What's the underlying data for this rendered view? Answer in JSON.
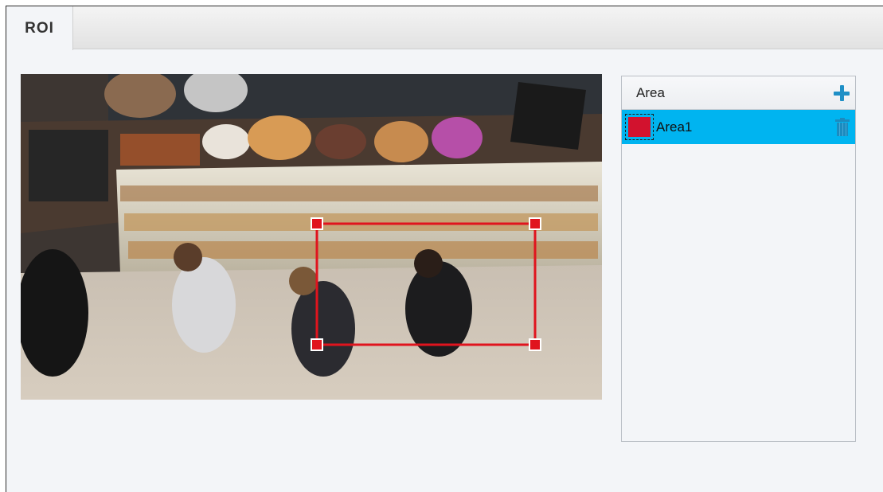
{
  "tabs": [
    {
      "label": "ROI",
      "active": true
    }
  ],
  "video": {
    "description_icon": "live-camera-view",
    "roi_color": "#e0141e"
  },
  "area_panel": {
    "header": "Area",
    "add_icon": "plus-icon",
    "items": [
      {
        "label": "Area1",
        "color": "#d2122e",
        "selected": true,
        "delete_icon": "trash-icon"
      }
    ]
  },
  "colors": {
    "selection": "#00b4f0",
    "accent": "#1e8fc6"
  }
}
